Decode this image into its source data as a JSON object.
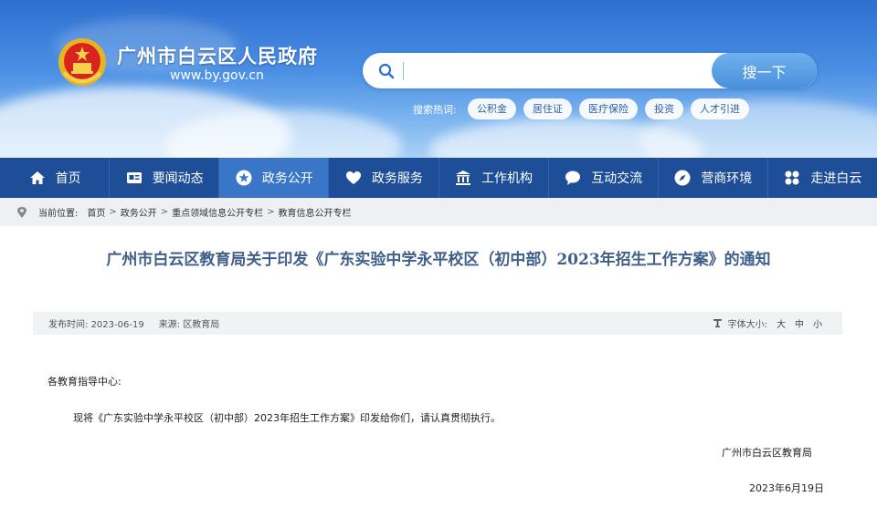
{
  "header": {
    "site_title": "广州市白云区人民政府",
    "site_url": "www.by.gov.cn",
    "search": {
      "placeholder": "",
      "button_label": "搜一下"
    },
    "hot_label": "搜索热词:",
    "hot_tags": [
      "公积金",
      "居住证",
      "医疗保险",
      "投资",
      "人才引进"
    ]
  },
  "nav": {
    "items": [
      {
        "label": "首页",
        "icon": "home-icon"
      },
      {
        "label": "要闻动态",
        "icon": "news-icon"
      },
      {
        "label": "政务公开",
        "icon": "star-badge-icon"
      },
      {
        "label": "政务服务",
        "icon": "heart-icon"
      },
      {
        "label": "工作机构",
        "icon": "building-icon"
      },
      {
        "label": "互动交流",
        "icon": "chat-icon"
      },
      {
        "label": "营商环境",
        "icon": "compass-icon"
      },
      {
        "label": "走进白云",
        "icon": "grid-icon"
      }
    ],
    "active_index": 2
  },
  "breadcrumb": {
    "label": "当前位置:",
    "items": [
      "首页",
      "政务公开",
      "重点领域信息公开专栏",
      "教育信息公开专栏"
    ],
    "separator": ">"
  },
  "article": {
    "title": "广州市白云区教育局关于印发《广东实验中学永平校区（初中部）2023年招生工作方案》的通知",
    "meta": {
      "date_label": "发布时间:",
      "date": "2023-06-19",
      "source_label": "来源:",
      "source": "区教育局",
      "font_size_label": "字体大小:",
      "font_sizes": [
        "大",
        "中",
        "小"
      ]
    },
    "salutation": "各教育指导中心:",
    "paragraph": "现将《广东实验中学永平校区（初中部）2023年招生工作方案》印发给你们，请认真贯彻执行。",
    "signature_org": "广州市白云区教育局",
    "signature_date": "2023年6月19日"
  },
  "colors": {
    "nav_bg": "#1d4e97",
    "nav_active": "#3a76c8",
    "title_color": "#3f5f8a"
  }
}
